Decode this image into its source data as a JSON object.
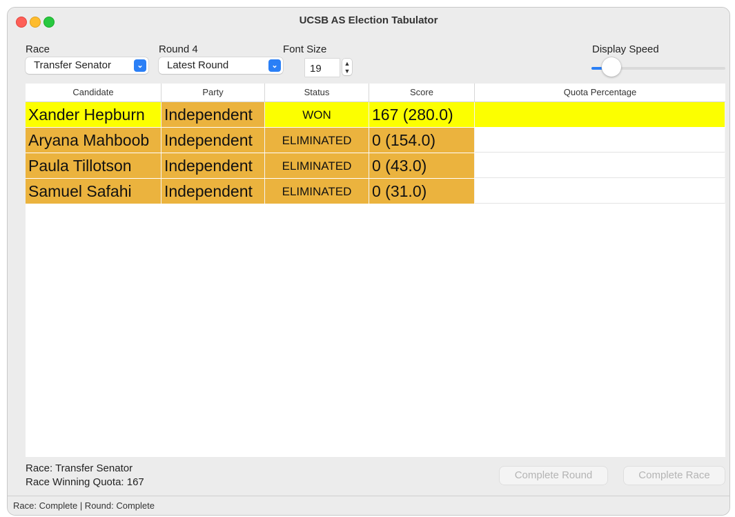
{
  "window": {
    "title": "UCSB AS Election Tabulator"
  },
  "controls": {
    "race_label": "Race",
    "race_value": "Transfer Senator",
    "round_label": "Round 4",
    "round_value": "Latest Round",
    "font_size_label": "Font Size",
    "font_size_value": "19",
    "display_speed_label": "Display Speed",
    "display_speed_level": 0.15
  },
  "table": {
    "headers": [
      "Candidate",
      "Party",
      "Status",
      "Score",
      "Quota Percentage"
    ],
    "rows": [
      {
        "candidate": "Xander Hepburn",
        "party": "Independent",
        "status": "WON",
        "score": "167 (280.0)",
        "quota": ""
      },
      {
        "candidate": "Aryana Mahboob",
        "party": "Independent",
        "status": "ELIMINATED",
        "score": "0 (154.0)",
        "quota": ""
      },
      {
        "candidate": "Paula Tillotson",
        "party": "Independent",
        "status": "ELIMINATED",
        "score": "0 (43.0)",
        "quota": ""
      },
      {
        "candidate": "Samuel Safahi",
        "party": "Independent",
        "status": "ELIMINATED",
        "score": "0 (31.0)",
        "quota": ""
      }
    ]
  },
  "colors": {
    "won": "#fcff00",
    "eliminated": "#ebb33e",
    "accent": "#2a7ff6"
  },
  "footer": {
    "race_info": "Race: Transfer Senator",
    "quota_info": "Race Winning Quota: 167",
    "complete_round_label": "Complete Round",
    "complete_race_label": "Complete Race"
  },
  "status_bar": {
    "text": "Race: Complete | Round: Complete"
  }
}
